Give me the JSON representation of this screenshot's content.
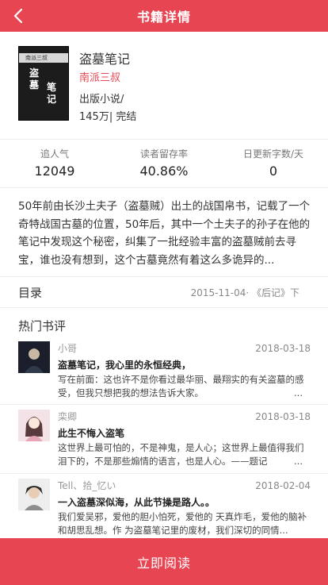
{
  "header": {
    "title": "书籍详情",
    "back_icon": "chevron-left-icon"
  },
  "book": {
    "cover": {
      "band_text": "南派三叔",
      "title_col1": "盗墓",
      "title_col2": "笔记"
    },
    "name": "盗墓笔记",
    "author": "南派三叔",
    "meta": "出版小说/ 145万| 完结"
  },
  "stats": [
    {
      "label": "追人气",
      "value": "12049"
    },
    {
      "label": "读者留存率",
      "value": "40.86%"
    },
    {
      "label": "日更新字数/天",
      "value": "0"
    }
  ],
  "description": "50年前由长沙土夫子（盗墓贼）出土的战国帛书，记载了一个奇特战国古墓的位置，50年后，其中一个土夫子的孙子在他的笔记中发现这个秘密，纠集了一批经验丰富的盗墓贼前去寻宝，谁也没有想到，这个古墓竟然有着这么多诡异的...",
  "toc": {
    "label": "目录",
    "latest": "2015-11-04· 《后记》下"
  },
  "reviews_title": "热门书评",
  "reviews": [
    {
      "user": "小哥",
      "date": "2018-03-18",
      "title": "盗墓笔记，我心里的永恒经典，",
      "content": "写在前面：这也许不是你看过最华丽、最翔实的有关盗墓的感受，但我只想把我的想法告诉大家。",
      "more": "..."
    },
    {
      "user": "栾卿",
      "date": "2018-03-18",
      "title": "此生不悔入盗笔",
      "content": "这世界上最可怕的，不是神鬼，是人心；这世界上最值得我们泪下的，不是那些煽情的语言，也是人心。——题记",
      "more": "..."
    },
    {
      "user": "Tell、拾_忆い",
      "date": "2018-02-04",
      "title": "一入盗墓深似海，从此节操是路人。。",
      "content": "我们爱吴邪，爱他的胆小怕死，爱他的 天真炸毛，爱他的脑补和胡思乱想。作 为盗墓笔记里的废材，我们深切的同情...",
      "more": ""
    }
  ],
  "footer": {
    "read_label": "立即阅读"
  },
  "colors": {
    "accent": "#e84553"
  }
}
